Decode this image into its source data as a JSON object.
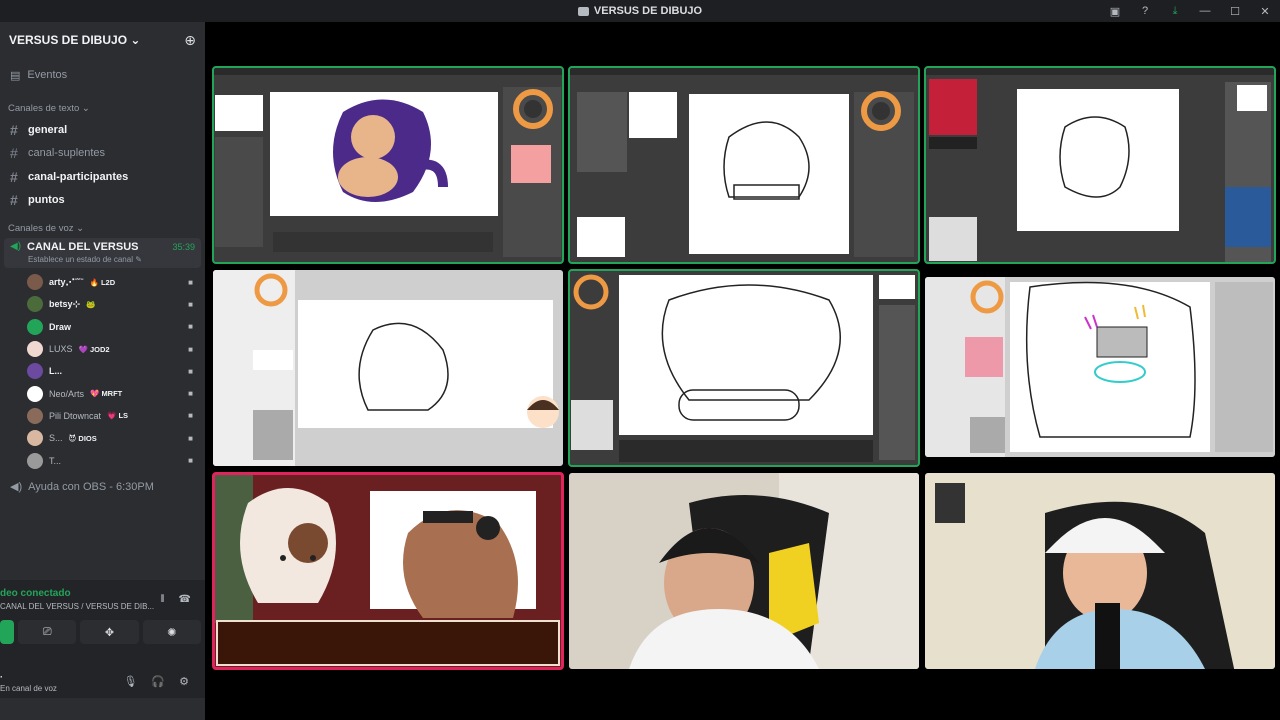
{
  "window": {
    "title": "VERSUS DE DIBUJO",
    "controls": [
      "screen-share-icon",
      "help-icon",
      "download-icon",
      "minimize-icon",
      "maximize-icon",
      "close-icon"
    ]
  },
  "server": {
    "name": "VERSUS DE DIBUJO ⌄",
    "events_label": "Eventos"
  },
  "text_category": "Canales de texto ⌄",
  "text_channels": [
    {
      "name": "general",
      "unread": true
    },
    {
      "name": "canal-suplentes",
      "unread": false
    },
    {
      "name": "canal-participantes",
      "unread": true
    },
    {
      "name": "puntos",
      "unread": true
    }
  ],
  "voice_category": "Canales de voz ⌄",
  "voice_channel": {
    "name": "CANAL DEL VERSUS",
    "timer": "35:39",
    "status_hint": "Establece un estado de canal ✎"
  },
  "voice_users": [
    {
      "name": "arty⋰ˉ˘ˉ",
      "tag": "🔥 L2D",
      "color": "#7a5a4a",
      "dim": false
    },
    {
      "name": "betsy⊹",
      "tag": "🐸",
      "color": "#4b6b3a",
      "dim": false
    },
    {
      "name": "Draw",
      "tag": "",
      "color": "#23a559",
      "dim": false
    },
    {
      "name": "LUXS",
      "tag": "💜 JOD2",
      "color": "#f0d8d0",
      "dim": true
    },
    {
      "name": "L...",
      "tag": "",
      "color": "#6b4aa0",
      "dim": false
    },
    {
      "name": "Neo/Arts",
      "tag": "💖 MRFT",
      "color": "#ffffff",
      "dim": true
    },
    {
      "name": "Pili Dtowncat",
      "tag": "💗 LS",
      "color": "#8a6a5a",
      "dim": true
    },
    {
      "name": "S...",
      "tag": "😈 DIOS",
      "color": "#d8b8a0",
      "dim": true
    },
    {
      "name": "T...",
      "tag": "",
      "color": "#9a9a9a",
      "dim": true
    }
  ],
  "other_voice_channel": "Ayuda con OBS - 6:30PM",
  "voice_panel": {
    "status": "deo conectado",
    "channel": "CANAL DEL VERSUS / VERSUS DE DIB..."
  },
  "user_panel": {
    "name": "·",
    "status": "En canal de voz"
  },
  "tiles": [
    {
      "kind": "drawing",
      "label": "screen-share-1",
      "speaking": true
    },
    {
      "kind": "drawing",
      "label": "screen-share-2",
      "speaking": true
    },
    {
      "kind": "drawing",
      "label": "screen-share-3",
      "speaking": true
    },
    {
      "kind": "drawing",
      "label": "screen-share-4",
      "speaking": false
    },
    {
      "kind": "drawing",
      "label": "screen-share-5",
      "speaking": true
    },
    {
      "kind": "drawing",
      "label": "screen-share-6",
      "speaking": false
    },
    {
      "kind": "stream",
      "label": "stream-overlay",
      "speaking": false
    },
    {
      "kind": "camera",
      "label": "webcam-1",
      "speaking": false
    },
    {
      "kind": "camera",
      "label": "webcam-2",
      "speaking": false
    }
  ]
}
